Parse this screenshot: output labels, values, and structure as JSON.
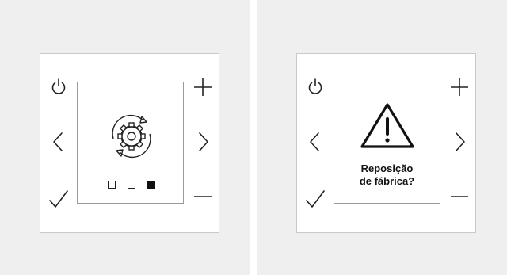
{
  "left_panel": {
    "progress": {
      "total_steps": 3,
      "current_step": 3
    }
  },
  "right_panel": {
    "message": {
      "line1": "Reposição",
      "line2": "de fábrica?"
    }
  },
  "icons": {
    "power": "power-icon",
    "back": "chevron-left-icon",
    "confirm": "checkmark-icon",
    "increase": "plus-icon",
    "forward": "chevron-right-icon",
    "decrease": "minus-icon",
    "reset": "gear-refresh-icon",
    "warning": "warning-triangle-icon"
  },
  "colors": {
    "background_panel": "#efefef",
    "icon_stroke": "#222222"
  }
}
